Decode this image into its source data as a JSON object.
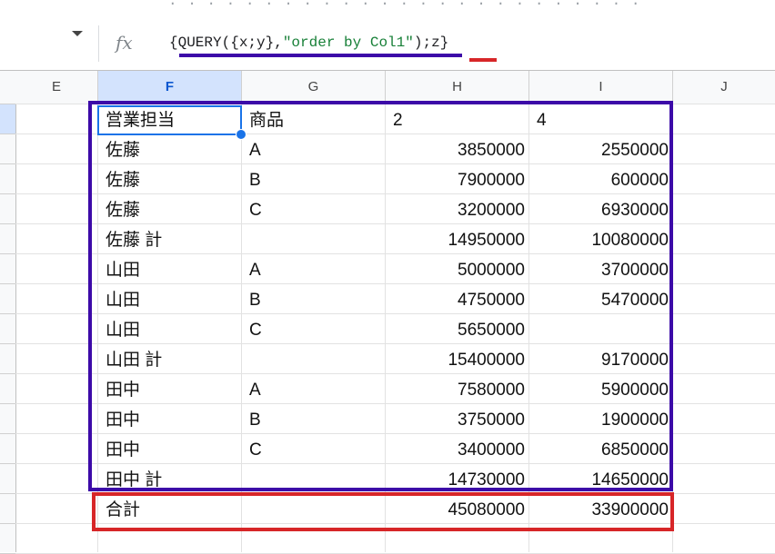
{
  "formula_bar": {
    "fx_label": "fx",
    "formula_open": "{QUERY({x;y},",
    "formula_string": "\"order by Col1\"",
    "formula_close": ");z}"
  },
  "grid": {
    "columns": [
      "E",
      "F",
      "G",
      "H",
      "I",
      "J"
    ],
    "selected_column": "F",
    "rows": [
      [
        "営業担当",
        "商品",
        "2",
        "4"
      ],
      [
        "佐藤",
        "A",
        "3850000",
        "2550000"
      ],
      [
        "佐藤",
        "B",
        "7900000",
        "600000"
      ],
      [
        "佐藤",
        "C",
        "3200000",
        "6930000"
      ],
      [
        "佐藤 計",
        "",
        "14950000",
        "10080000"
      ],
      [
        "山田",
        "A",
        "5000000",
        "3700000"
      ],
      [
        "山田",
        "B",
        "4750000",
        "5470000"
      ],
      [
        "山田",
        "C",
        "5650000",
        ""
      ],
      [
        "山田 計",
        "",
        "15400000",
        "9170000"
      ],
      [
        "田中",
        "A",
        "7580000",
        "5900000"
      ],
      [
        "田中",
        "B",
        "3750000",
        "1900000"
      ],
      [
        "田中",
        "C",
        "3400000",
        "6850000"
      ],
      [
        "田中 計",
        "",
        "14730000",
        "14650000"
      ],
      [
        "合計",
        "",
        "45080000",
        "33900000"
      ]
    ]
  },
  "annotations": {
    "purple": "#3c0aa8",
    "red": "#d72628"
  }
}
